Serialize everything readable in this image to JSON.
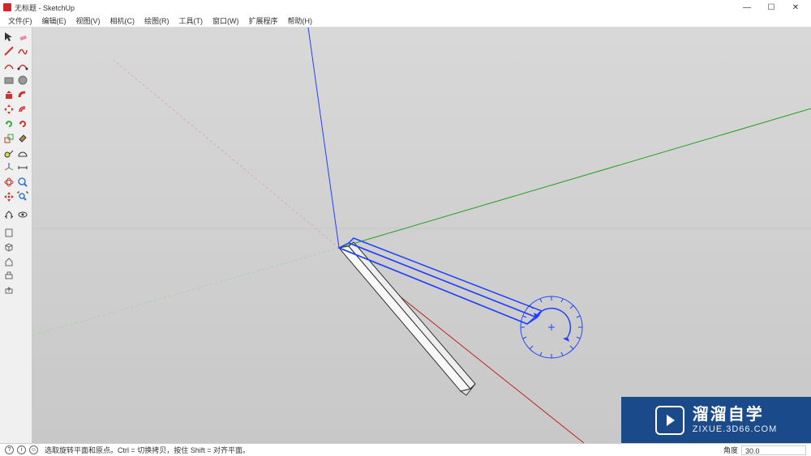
{
  "titlebar": {
    "title": "无标题 - SketchUp"
  },
  "window_controls": {
    "minimize": "—",
    "maximize": "☐",
    "close": "✕"
  },
  "menubar": {
    "items": [
      "文件(F)",
      "编辑(E)",
      "视图(V)",
      "相机(C)",
      "绘图(R)",
      "工具(T)",
      "窗口(W)",
      "扩展程序",
      "帮助(H)"
    ]
  },
  "toolbar": {
    "left_col": [
      "select-icon",
      "line-icon",
      "arc-icon",
      "rect-icon",
      "pushpull-icon",
      "move-icon",
      "scale-icon",
      "rotate-icon",
      "eraser-icon",
      "tape-icon",
      "axes-icon",
      "orbit-icon",
      "pan-icon",
      "blank",
      "walk-icon",
      "blank",
      "blank",
      "box-icon",
      "blank",
      "blank",
      "blank"
    ],
    "right_col": [
      "eraser2-icon",
      "freehand-icon",
      "arc2-icon",
      "circle-icon",
      "followme-icon",
      "offset-icon",
      "scale2-icon",
      "rotate2-icon",
      "paint-icon",
      "protractor-icon",
      "dimension-icon",
      "zoom-icon",
      "zoomext-icon",
      "blank",
      "look-icon",
      "blank",
      "blank",
      "blank",
      "blank"
    ]
  },
  "statusbar": {
    "hint": "选取旋转平面和原点。Ctrl = 切换拷贝，按住 Shift = 对齐平面。",
    "angle_label": "角度",
    "angle_value": "30.0"
  },
  "watermark": {
    "title": "溜溜自学",
    "subtitle": "ZIXUE.3D66.COM"
  }
}
